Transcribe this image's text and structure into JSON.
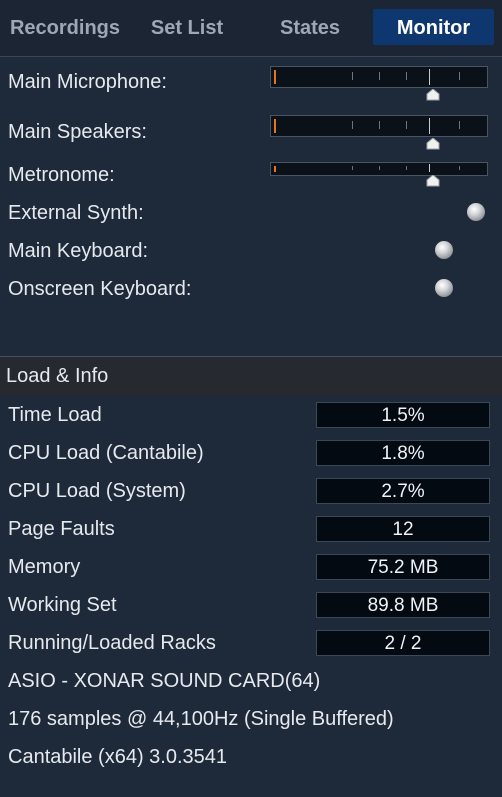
{
  "tabs": [
    {
      "label": "Recordings",
      "active": false
    },
    {
      "label": "Set List",
      "active": false
    },
    {
      "label": "States",
      "active": false
    },
    {
      "label": "Monitor",
      "active": true
    }
  ],
  "levels": [
    {
      "label": "Main Microphone:",
      "control": "slider",
      "level": 0.73
    },
    {
      "label": "Main Speakers:",
      "control": "slider",
      "level": 0.73
    },
    {
      "label": "Metronome:",
      "control": "slider",
      "level": 0.73
    },
    {
      "label": "External Synth:",
      "control": "led"
    },
    {
      "label": "Main Keyboard:",
      "control": "led"
    },
    {
      "label": "Onscreen Keyboard:",
      "control": "led"
    }
  ],
  "section": {
    "title": "Load & Info"
  },
  "info": [
    {
      "label": "Time Load",
      "value": "1.5%"
    },
    {
      "label": "CPU Load (Cantabile)",
      "value": "1.8%"
    },
    {
      "label": "CPU Load (System)",
      "value": "2.7%"
    },
    {
      "label": "Page Faults",
      "value": "12"
    },
    {
      "label": "Memory",
      "value": "75.2 MB"
    },
    {
      "label": "Working Set",
      "value": "89.8 MB"
    },
    {
      "label": "Running/Loaded Racks",
      "value": "2 / 2"
    }
  ],
  "footer": {
    "driver": "ASIO - XONAR SOUND CARD(64)",
    "buffer": "176 samples @ 44,100Hz (Single Buffered)",
    "version": "Cantabile (x64) 3.0.3541"
  },
  "colors": {
    "background": "#1e2a3a",
    "active_tab": "#0e3770",
    "zero_marker": "#e8741a",
    "value_box": "#040a12"
  }
}
